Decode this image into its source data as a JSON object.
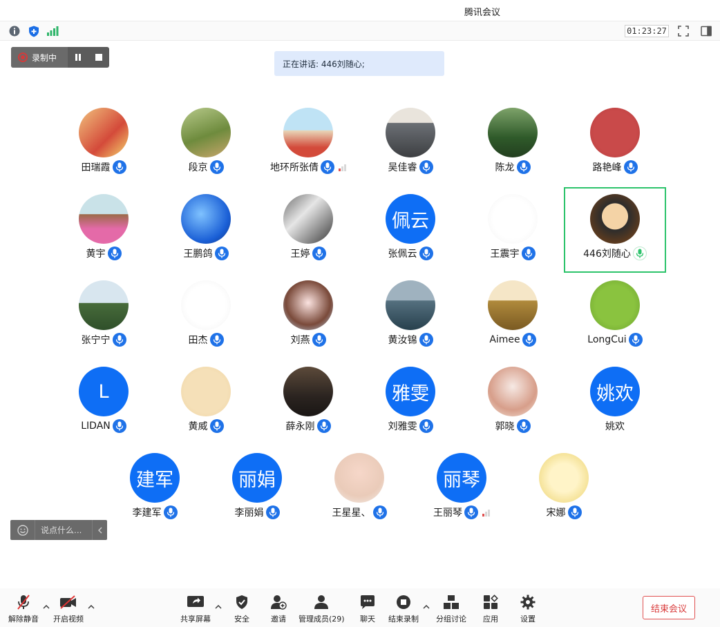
{
  "window": {
    "title": "腾讯会议"
  },
  "topbar": {
    "timer": "01:23:27",
    "icons": [
      "info-icon",
      "shield-icon",
      "signal-bars-icon",
      "fullscreen-icon",
      "sidebar-icon"
    ]
  },
  "recording": {
    "label": "录制中"
  },
  "speaking": {
    "text": "正在讲话: 446刘随心;"
  },
  "participants": [
    {
      "name": "田瑞霞",
      "avatar": "photo",
      "mic": "blue"
    },
    {
      "name": "段京",
      "avatar": "photo",
      "mic": "blue"
    },
    {
      "name": "地环所张倩",
      "avatar": "photo",
      "mic": "blue",
      "signal": true
    },
    {
      "name": "吴佳睿",
      "avatar": "photo",
      "mic": "blue"
    },
    {
      "name": "陈龙",
      "avatar": "photo",
      "mic": "blue"
    },
    {
      "name": "路艳峰",
      "avatar": "photo",
      "mic": "blue"
    },
    {
      "name": "黄宇",
      "avatar": "photo",
      "mic": "blue"
    },
    {
      "name": "王鹏鸽",
      "avatar": "photo",
      "mic": "blue"
    },
    {
      "name": "王婷",
      "avatar": "photo",
      "mic": "blue"
    },
    {
      "name": "张佩云",
      "avatar": "text",
      "avatar_text": "佩云",
      "mic": "blue"
    },
    {
      "name": "王震宇",
      "avatar": "photo",
      "mic": "blue"
    },
    {
      "name": "446刘随心",
      "avatar": "photo",
      "mic": "green",
      "active": true
    },
    {
      "name": "张宁宁",
      "avatar": "photo",
      "mic": "blue"
    },
    {
      "name": "田杰",
      "avatar": "photo",
      "mic": "blue"
    },
    {
      "name": "刘燕",
      "avatar": "photo",
      "mic": "blue"
    },
    {
      "name": "黄汝锦",
      "avatar": "photo",
      "mic": "blue"
    },
    {
      "name": "Aimee",
      "avatar": "photo",
      "mic": "blue"
    },
    {
      "name": "LongCui",
      "avatar": "photo",
      "mic": "blue"
    },
    {
      "name": "LIDAN",
      "avatar": "text",
      "avatar_text": "L",
      "mic": "blue"
    },
    {
      "name": "黄威",
      "avatar": "photo",
      "mic": "blue"
    },
    {
      "name": "薛永刚",
      "avatar": "photo",
      "mic": "blue"
    },
    {
      "name": "刘雅雯",
      "avatar": "text",
      "avatar_text": "雅雯",
      "mic": "blue"
    },
    {
      "name": "郭晓",
      "avatar": "photo",
      "mic": "blue"
    },
    {
      "name": "姚欢",
      "avatar": "text",
      "avatar_text": "姚欢",
      "mic": "none"
    },
    {
      "name": "李建军",
      "avatar": "text",
      "avatar_text": "建军",
      "mic": "blue"
    },
    {
      "name": "李丽娟",
      "avatar": "text",
      "avatar_text": "丽娟",
      "mic": "blue"
    },
    {
      "name": "王星星、",
      "avatar": "photo",
      "mic": "blue"
    },
    {
      "name": "王丽琴",
      "avatar": "text",
      "avatar_text": "丽琴",
      "mic": "blue",
      "signal": true
    },
    {
      "name": "宋娜",
      "avatar": "photo",
      "mic": "blue"
    }
  ],
  "chat": {
    "placeholder": "说点什么..."
  },
  "bottombar": {
    "unmute": "解除静音",
    "start_video": "开启视频",
    "share_screen": "共享屏幕",
    "security": "安全",
    "invite": "邀请",
    "manage_members": "管理成员(29)",
    "chat": "聊天",
    "end_recording": "结束录制",
    "breakout": "分组讨论",
    "apps": "应用",
    "settings": "设置",
    "end_meeting": "结束会议"
  },
  "colors": {
    "accent_blue": "#0e6ef5",
    "active_border": "#2cc36b",
    "danger": "#d93b3b"
  }
}
